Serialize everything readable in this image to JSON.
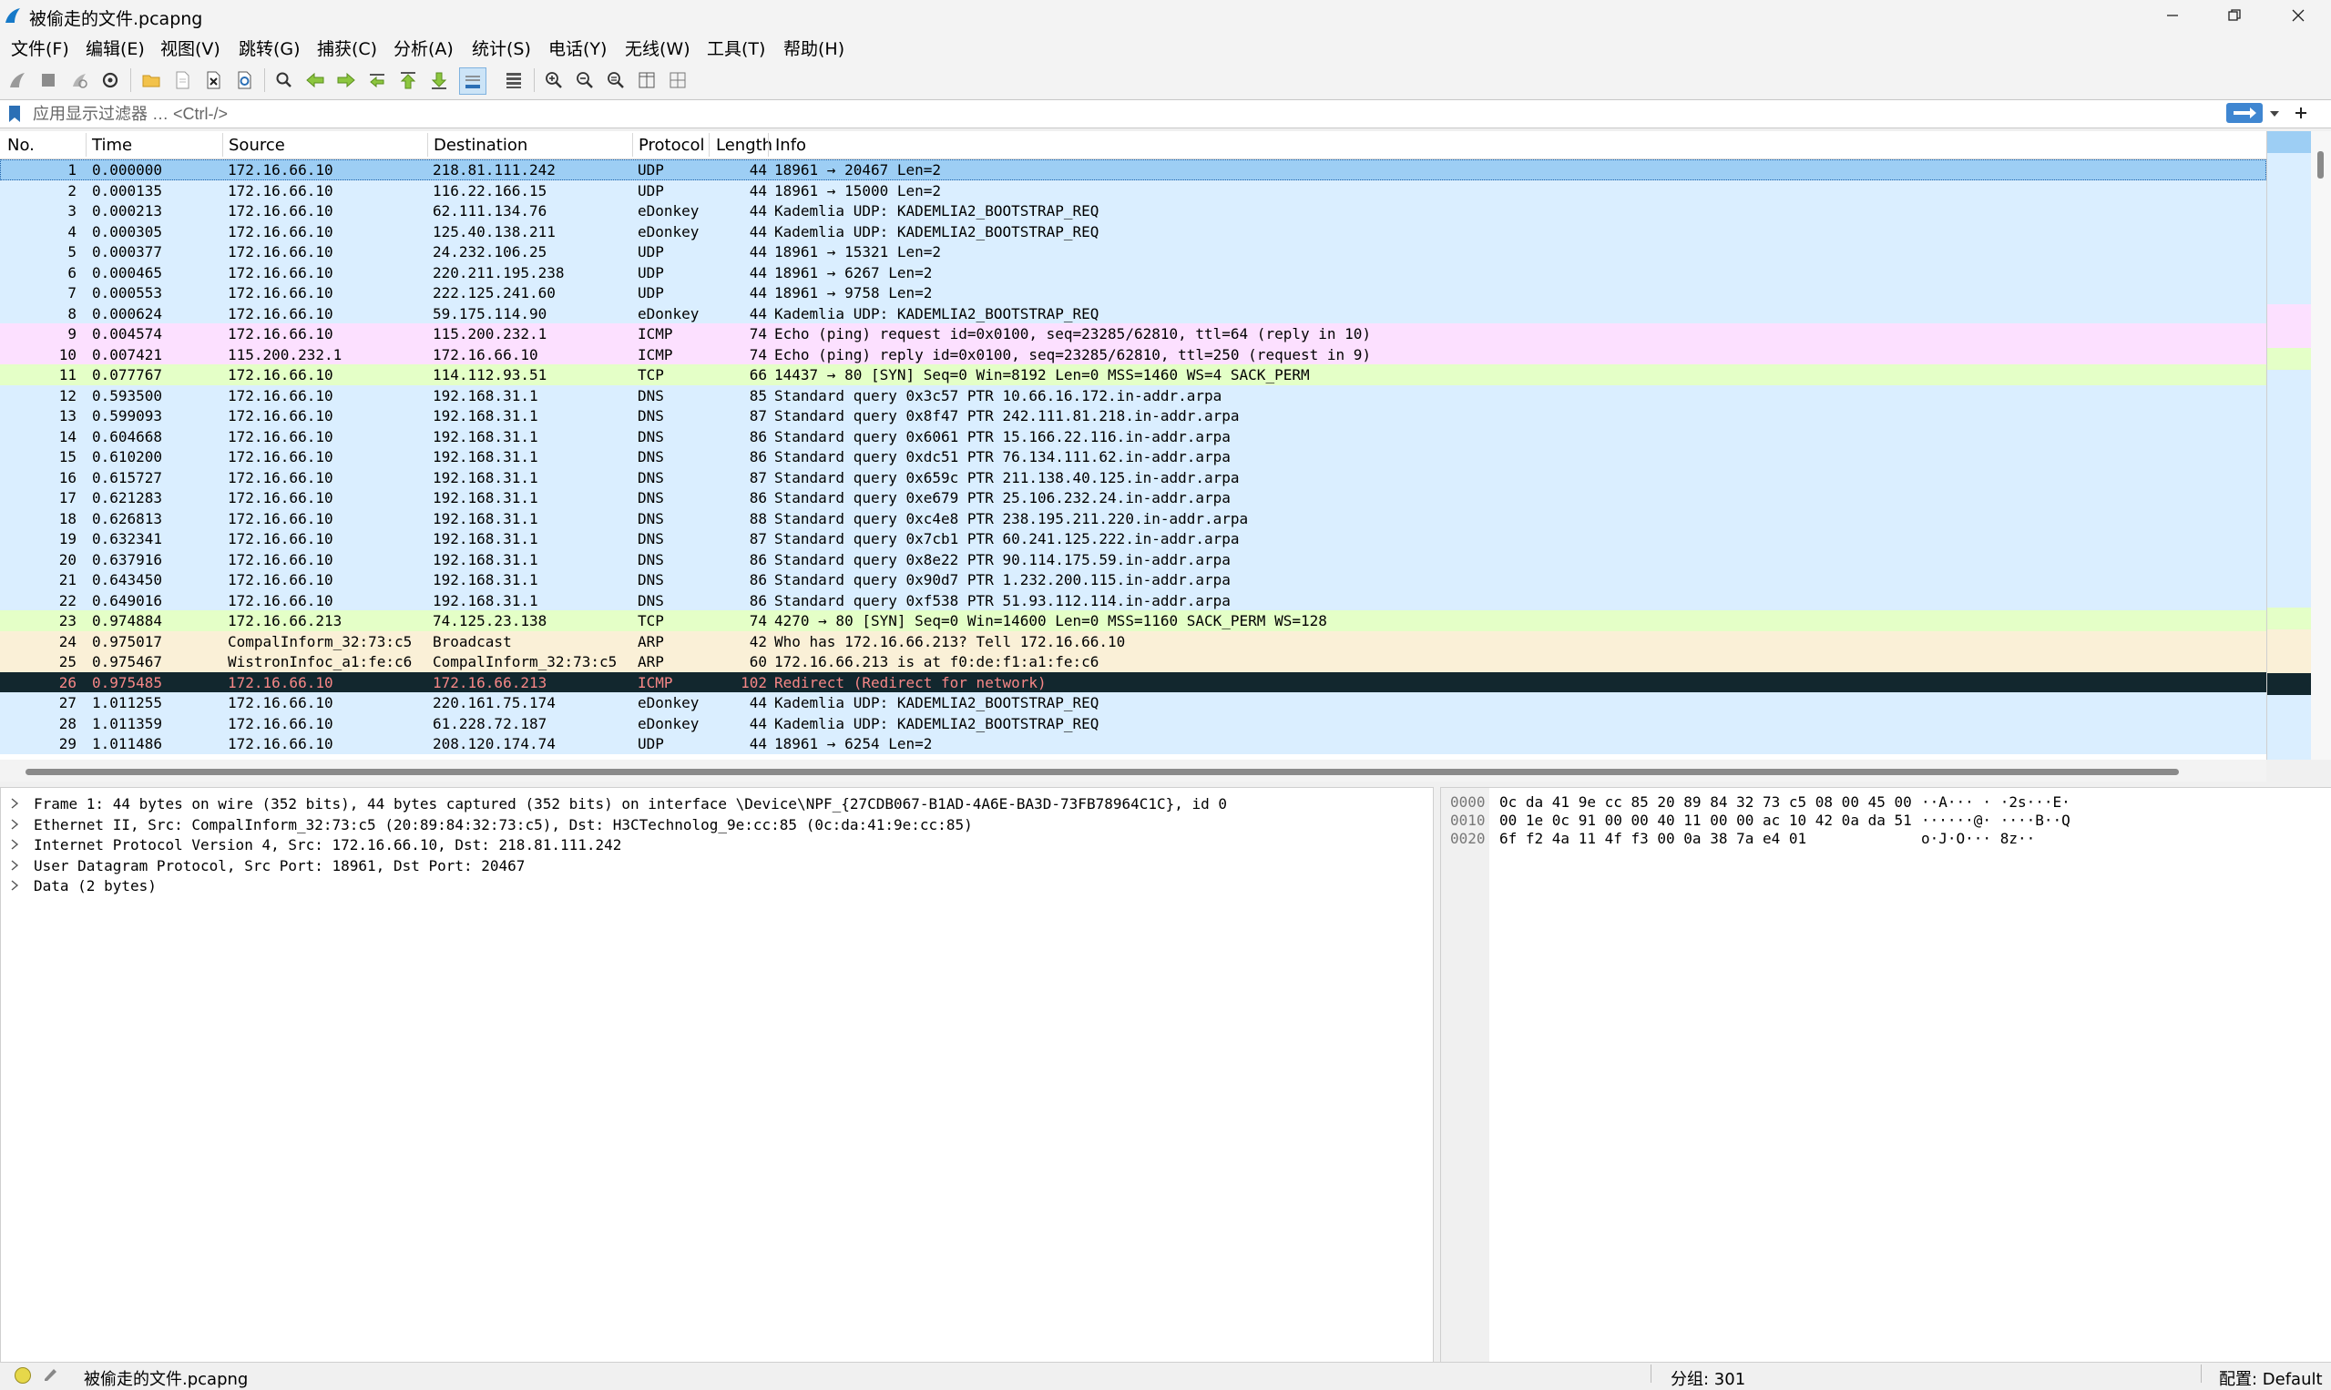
{
  "window": {
    "title": "被偷走的文件.pcapng"
  },
  "menu": [
    {
      "label": "文件(F)"
    },
    {
      "label": "编辑(E)"
    },
    {
      "label": "视图(V)"
    },
    {
      "label": "跳转(G)"
    },
    {
      "label": "捕获(C)"
    },
    {
      "label": "分析(A)"
    },
    {
      "label": "统计(S)"
    },
    {
      "label": "电话(Y)"
    },
    {
      "label": "无线(W)"
    },
    {
      "label": "工具(T)"
    },
    {
      "label": "帮助(H)"
    }
  ],
  "filter": {
    "placeholder": "应用显示过滤器 … <Ctrl-/>",
    "value": ""
  },
  "columns": {
    "no": "No.",
    "time": "Time",
    "source": "Source",
    "destination": "Destination",
    "protocol": "Protocol",
    "length": "Length",
    "info": "Info"
  },
  "colors": {
    "udp": "#daeeff",
    "icmp": "#fce0ff",
    "tcp": "#e7e6ff",
    "tcp_syn": "#e4ffc7",
    "arp": "#faf0d7",
    "selected": "#9dcef4",
    "error_row": "#12272e",
    "error_text": "#f78787"
  },
  "packets": [
    {
      "no": "1",
      "time": "0.000000",
      "source": "172.16.66.10",
      "destination": "218.81.111.242",
      "protocol": "UDP",
      "length": "44",
      "info": "18961 → 20467 Len=2",
      "kind": "selected"
    },
    {
      "no": "2",
      "time": "0.000135",
      "source": "172.16.66.10",
      "destination": "116.22.166.15",
      "protocol": "UDP",
      "length": "44",
      "info": "18961 → 15000 Len=2",
      "kind": "udp"
    },
    {
      "no": "3",
      "time": "0.000213",
      "source": "172.16.66.10",
      "destination": "62.111.134.76",
      "protocol": "eDonkey",
      "length": "44",
      "info": "Kademlia UDP: KADEMLIA2_BOOTSTRAP_REQ",
      "kind": "udp"
    },
    {
      "no": "4",
      "time": "0.000305",
      "source": "172.16.66.10",
      "destination": "125.40.138.211",
      "protocol": "eDonkey",
      "length": "44",
      "info": "Kademlia UDP: KADEMLIA2_BOOTSTRAP_REQ",
      "kind": "udp"
    },
    {
      "no": "5",
      "time": "0.000377",
      "source": "172.16.66.10",
      "destination": "24.232.106.25",
      "protocol": "UDP",
      "length": "44",
      "info": "18961 → 15321 Len=2",
      "kind": "udp"
    },
    {
      "no": "6",
      "time": "0.000465",
      "source": "172.16.66.10",
      "destination": "220.211.195.238",
      "protocol": "UDP",
      "length": "44",
      "info": "18961 → 6267 Len=2",
      "kind": "udp"
    },
    {
      "no": "7",
      "time": "0.000553",
      "source": "172.16.66.10",
      "destination": "222.125.241.60",
      "protocol": "UDP",
      "length": "44",
      "info": "18961 → 9758 Len=2",
      "kind": "udp"
    },
    {
      "no": "8",
      "time": "0.000624",
      "source": "172.16.66.10",
      "destination": "59.175.114.90",
      "protocol": "eDonkey",
      "length": "44",
      "info": "Kademlia UDP: KADEMLIA2_BOOTSTRAP_REQ",
      "kind": "udp"
    },
    {
      "no": "9",
      "time": "0.004574",
      "source": "172.16.66.10",
      "destination": "115.200.232.1",
      "protocol": "ICMP",
      "length": "74",
      "info": "Echo (ping) request  id=0x0100, seq=23285/62810, ttl=64 (reply in 10)",
      "kind": "icmp"
    },
    {
      "no": "10",
      "time": "0.007421",
      "source": "115.200.232.1",
      "destination": "172.16.66.10",
      "protocol": "ICMP",
      "length": "74",
      "info": "Echo (ping) reply    id=0x0100, seq=23285/62810, ttl=250 (request in 9)",
      "kind": "icmp"
    },
    {
      "no": "11",
      "time": "0.077767",
      "source": "172.16.66.10",
      "destination": "114.112.93.51",
      "protocol": "TCP",
      "length": "66",
      "info": "14437 → 80 [SYN] Seq=0 Win=8192 Len=0 MSS=1460 WS=4 SACK_PERM",
      "kind": "tcp_syn"
    },
    {
      "no": "12",
      "time": "0.593500",
      "source": "172.16.66.10",
      "destination": "192.168.31.1",
      "protocol": "DNS",
      "length": "85",
      "info": "Standard query 0x3c57 PTR 10.66.16.172.in-addr.arpa",
      "kind": "udp"
    },
    {
      "no": "13",
      "time": "0.599093",
      "source": "172.16.66.10",
      "destination": "192.168.31.1",
      "protocol": "DNS",
      "length": "87",
      "info": "Standard query 0x8f47 PTR 242.111.81.218.in-addr.arpa",
      "kind": "udp"
    },
    {
      "no": "14",
      "time": "0.604668",
      "source": "172.16.66.10",
      "destination": "192.168.31.1",
      "protocol": "DNS",
      "length": "86",
      "info": "Standard query 0x6061 PTR 15.166.22.116.in-addr.arpa",
      "kind": "udp"
    },
    {
      "no": "15",
      "time": "0.610200",
      "source": "172.16.66.10",
      "destination": "192.168.31.1",
      "protocol": "DNS",
      "length": "86",
      "info": "Standard query 0xdc51 PTR 76.134.111.62.in-addr.arpa",
      "kind": "udp"
    },
    {
      "no": "16",
      "time": "0.615727",
      "source": "172.16.66.10",
      "destination": "192.168.31.1",
      "protocol": "DNS",
      "length": "87",
      "info": "Standard query 0x659c PTR 211.138.40.125.in-addr.arpa",
      "kind": "udp"
    },
    {
      "no": "17",
      "time": "0.621283",
      "source": "172.16.66.10",
      "destination": "192.168.31.1",
      "protocol": "DNS",
      "length": "86",
      "info": "Standard query 0xe679 PTR 25.106.232.24.in-addr.arpa",
      "kind": "udp"
    },
    {
      "no": "18",
      "time": "0.626813",
      "source": "172.16.66.10",
      "destination": "192.168.31.1",
      "protocol": "DNS",
      "length": "88",
      "info": "Standard query 0xc4e8 PTR 238.195.211.220.in-addr.arpa",
      "kind": "udp"
    },
    {
      "no": "19",
      "time": "0.632341",
      "source": "172.16.66.10",
      "destination": "192.168.31.1",
      "protocol": "DNS",
      "length": "87",
      "info": "Standard query 0x7cb1 PTR 60.241.125.222.in-addr.arpa",
      "kind": "udp"
    },
    {
      "no": "20",
      "time": "0.637916",
      "source": "172.16.66.10",
      "destination": "192.168.31.1",
      "protocol": "DNS",
      "length": "86",
      "info": "Standard query 0x8e22 PTR 90.114.175.59.in-addr.arpa",
      "kind": "udp"
    },
    {
      "no": "21",
      "time": "0.643450",
      "source": "172.16.66.10",
      "destination": "192.168.31.1",
      "protocol": "DNS",
      "length": "86",
      "info": "Standard query 0x90d7 PTR 1.232.200.115.in-addr.arpa",
      "kind": "udp"
    },
    {
      "no": "22",
      "time": "0.649016",
      "source": "172.16.66.10",
      "destination": "192.168.31.1",
      "protocol": "DNS",
      "length": "86",
      "info": "Standard query 0xf538 PTR 51.93.112.114.in-addr.arpa",
      "kind": "udp"
    },
    {
      "no": "23",
      "time": "0.974884",
      "source": "172.16.66.213",
      "destination": "74.125.23.138",
      "protocol": "TCP",
      "length": "74",
      "info": "4270 → 80 [SYN] Seq=0 Win=14600 Len=0 MSS=1160 SACK_PERM WS=128",
      "kind": "tcp_syn"
    },
    {
      "no": "24",
      "time": "0.975017",
      "source": "CompalInform_32:73:c5",
      "destination": "Broadcast",
      "protocol": "ARP",
      "length": "42",
      "info": "Who has 172.16.66.213? Tell 172.16.66.10",
      "kind": "arp"
    },
    {
      "no": "25",
      "time": "0.975467",
      "source": "WistronInfoc_a1:fe:c6",
      "destination": "CompalInform_32:73:c5",
      "protocol": "ARP",
      "length": "60",
      "info": "172.16.66.213 is at f0:de:f1:a1:fe:c6",
      "kind": "arp"
    },
    {
      "no": "26",
      "time": "0.975485",
      "source": "172.16.66.10",
      "destination": "172.16.66.213",
      "protocol": "ICMP",
      "length": "102",
      "info": "Redirect             (Redirect for network)",
      "kind": "error"
    },
    {
      "no": "27",
      "time": "1.011255",
      "source": "172.16.66.10",
      "destination": "220.161.75.174",
      "protocol": "eDonkey",
      "length": "44",
      "info": "Kademlia UDP: KADEMLIA2_BOOTSTRAP_REQ",
      "kind": "udp"
    },
    {
      "no": "28",
      "time": "1.011359",
      "source": "172.16.66.10",
      "destination": "61.228.72.187",
      "protocol": "eDonkey",
      "length": "44",
      "info": "Kademlia UDP: KADEMLIA2_BOOTSTRAP_REQ",
      "kind": "udp"
    },
    {
      "no": "29",
      "time": "1.011486",
      "source": "172.16.66.10",
      "destination": "208.120.174.74",
      "protocol": "UDP",
      "length": "44",
      "info": "18961 → 6254 Len=2",
      "kind": "udp"
    }
  ],
  "details": [
    "Frame 1: 44 bytes on wire (352 bits), 44 bytes captured (352 bits) on interface \\Device\\NPF_{27CDB067-B1AD-4A6E-BA3D-73FB78964C1C}, id 0",
    "Ethernet II, Src: CompalInform_32:73:c5 (20:89:84:32:73:c5), Dst: H3CTechnolog_9e:cc:85 (0c:da:41:9e:cc:85)",
    "Internet Protocol Version 4, Src: 172.16.66.10, Dst: 218.81.111.242",
    "User Datagram Protocol, Src Port: 18961, Dst Port: 20467",
    "Data (2 bytes)"
  ],
  "bytes": [
    {
      "offset": "0000",
      "hex": "0c da 41 9e cc 85 20 89  84 32 73 c5 08 00 45 00",
      "ascii": "··A··· · ·2s···E·"
    },
    {
      "offset": "0010",
      "hex": "00 1e 0c 91 00 00 40 11  00 00 ac 10 42 0a da 51",
      "ascii": "······@· ····B··Q"
    },
    {
      "offset": "0020",
      "hex": "6f f2 4a 11 4f f3 00 0a  38 7a e4 01",
      "ascii": "o·J·O··· 8z··"
    }
  ],
  "status": {
    "filename": "被偷走的文件.pcapng",
    "packets": "分组: 301",
    "profile": "配置: Default"
  }
}
